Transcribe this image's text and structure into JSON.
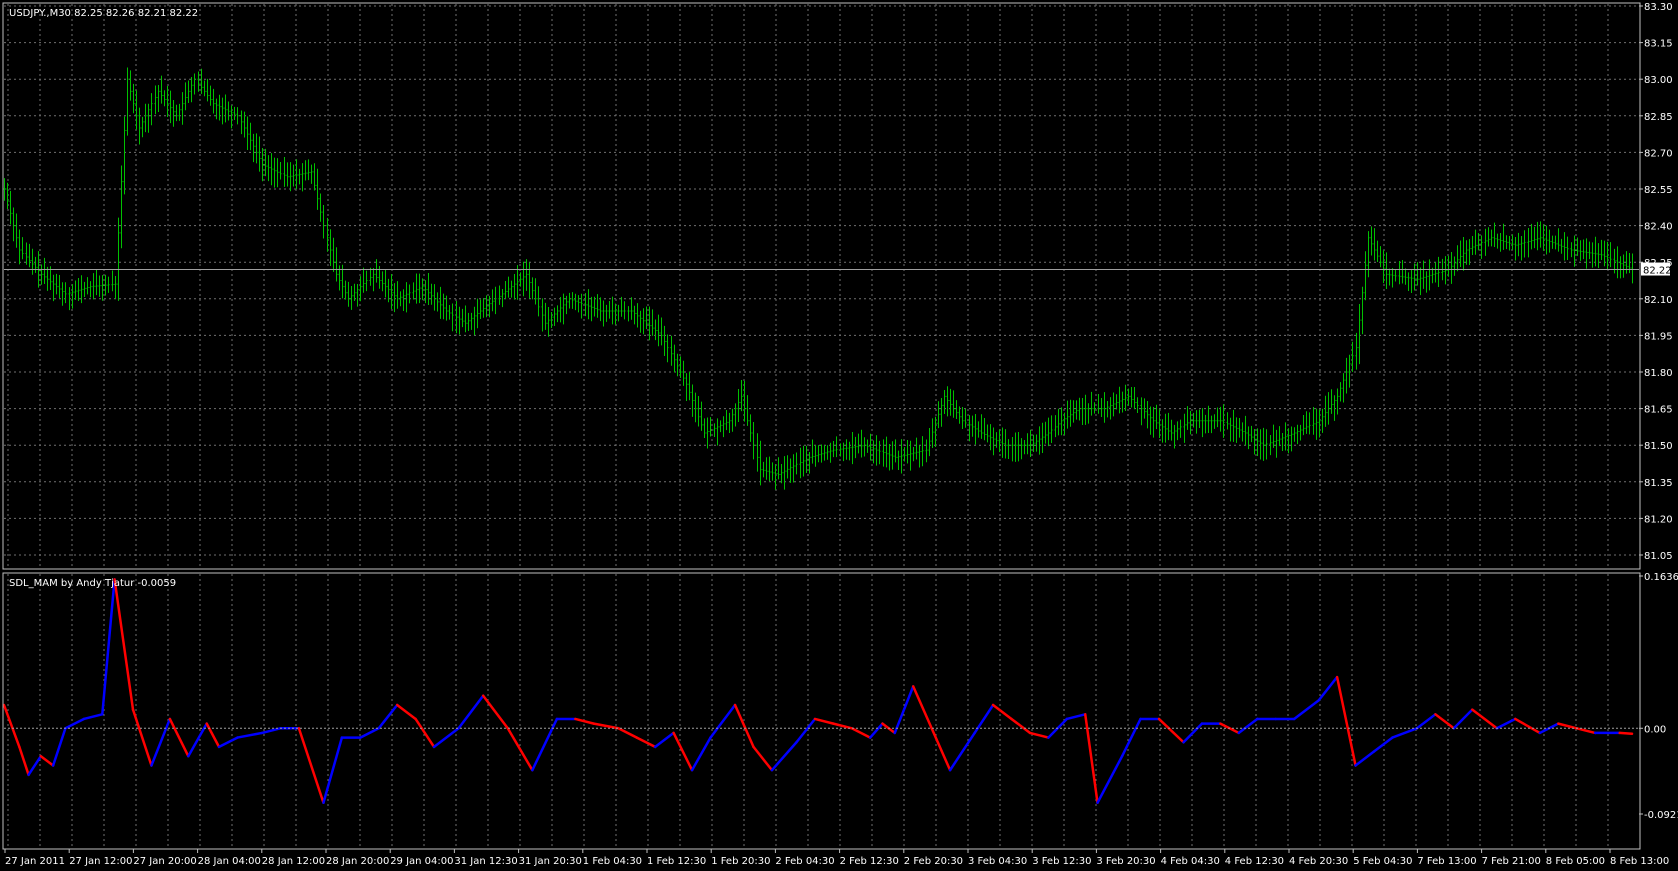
{
  "main": {
    "legend": "USDJPY.,M30  82.25 82.26 82.21 82.22",
    "price_label": "82.22",
    "y_ticks": [
      "83.30",
      "83.15",
      "83.00",
      "82.85",
      "82.70",
      "82.55",
      "82.40",
      "82.25",
      "82.10",
      "81.95",
      "81.80",
      "81.65",
      "81.50",
      "81.35",
      "81.20",
      "81.05"
    ]
  },
  "indicator": {
    "legend": "SDL_MAM by Andy Tjatur -0.0059",
    "y_ticks": [
      "0.1636",
      "0.00",
      "-0.0921"
    ]
  },
  "x_ticks": [
    "27 Jan 2011",
    "27 Jan 12:00",
    "27 Jan 20:00",
    "28 Jan 04:00",
    "28 Jan 12:00",
    "28 Jan 20:00",
    "29 Jan 04:00",
    "31 Jan 12:30",
    "31 Jan 20:30",
    "1 Feb 04:30",
    "1 Feb 12:30",
    "1 Feb 20:30",
    "2 Feb 04:30",
    "2 Feb 12:30",
    "2 Feb 20:30",
    "3 Feb 04:30",
    "3 Feb 12:30",
    "3 Feb 20:30",
    "4 Feb 04:30",
    "4 Feb 12:30",
    "4 Feb 20:30",
    "5 Feb 04:30",
    "7 Feb 13:00",
    "7 Feb 21:00",
    "8 Feb 05:00",
    "8 Feb 13:00"
  ],
  "colors": {
    "background": "#000000",
    "grid": "#707070",
    "bars": "#00c000",
    "osc_up": "#0000ff",
    "osc_down": "#ff0000",
    "text": "#ffffff"
  },
  "chart_data": [
    {
      "type": "line",
      "title": "USDJPY.,M30",
      "ylim": [
        81.05,
        83.3
      ],
      "close_path": [
        [
          0,
          82.55
        ],
        [
          5,
          82.3
        ],
        [
          12,
          82.2
        ],
        [
          20,
          82.12
        ],
        [
          28,
          82.15
        ],
        [
          36,
          82.16
        ],
        [
          40,
          83.0
        ],
        [
          44,
          82.8
        ],
        [
          50,
          82.95
        ],
        [
          56,
          82.85
        ],
        [
          62,
          83.0
        ],
        [
          68,
          82.9
        ],
        [
          76,
          82.85
        ],
        [
          84,
          82.65
        ],
        [
          92,
          82.6
        ],
        [
          100,
          82.62
        ],
        [
          104,
          82.4
        ],
        [
          108,
          82.2
        ],
        [
          112,
          82.1
        ],
        [
          120,
          82.2
        ],
        [
          128,
          82.1
        ],
        [
          136,
          82.15
        ],
        [
          144,
          82.05
        ],
        [
          150,
          82.0
        ],
        [
          160,
          82.1
        ],
        [
          170,
          82.2
        ],
        [
          176,
          82.0
        ],
        [
          184,
          82.1
        ],
        [
          194,
          82.05
        ],
        [
          204,
          82.05
        ],
        [
          214,
          81.95
        ],
        [
          222,
          81.75
        ],
        [
          228,
          81.55
        ],
        [
          236,
          81.6
        ],
        [
          240,
          81.7
        ],
        [
          246,
          81.4
        ],
        [
          252,
          81.38
        ],
        [
          262,
          81.45
        ],
        [
          270,
          81.48
        ],
        [
          280,
          81.5
        ],
        [
          290,
          81.45
        ],
        [
          300,
          81.48
        ],
        [
          306,
          81.7
        ],
        [
          312,
          81.6
        ],
        [
          318,
          81.55
        ],
        [
          326,
          81.5
        ],
        [
          334,
          81.5
        ],
        [
          340,
          81.55
        ],
        [
          344,
          81.6
        ],
        [
          350,
          81.65
        ],
        [
          358,
          81.65
        ],
        [
          366,
          81.7
        ],
        [
          374,
          81.6
        ],
        [
          380,
          81.55
        ],
        [
          386,
          81.6
        ],
        [
          396,
          81.6
        ],
        [
          404,
          81.55
        ],
        [
          410,
          81.5
        ],
        [
          420,
          81.55
        ],
        [
          428,
          81.6
        ],
        [
          434,
          81.7
        ],
        [
          440,
          81.9
        ],
        [
          444,
          82.35
        ],
        [
          450,
          82.2
        ],
        [
          460,
          82.18
        ],
        [
          470,
          82.22
        ],
        [
          476,
          82.3
        ],
        [
          484,
          82.35
        ],
        [
          492,
          82.32
        ],
        [
          500,
          82.35
        ],
        [
          510,
          82.3
        ],
        [
          520,
          82.28
        ],
        [
          530,
          82.22
        ]
      ],
      "x": [
        "27 Jan 2011",
        "27 Jan 12:00",
        "27 Jan 20:00",
        "28 Jan 04:00",
        "28 Jan 12:00",
        "28 Jan 20:00",
        "29 Jan 04:00",
        "31 Jan 12:30",
        "31 Jan 20:30",
        "1 Feb 04:30",
        "1 Feb 12:30",
        "1 Feb 20:30",
        "2 Feb 04:30",
        "2 Feb 12:30",
        "2 Feb 20:30",
        "3 Feb 04:30",
        "3 Feb 12:30",
        "3 Feb 20:30",
        "4 Feb 04:30",
        "4 Feb 12:30",
        "4 Feb 20:30",
        "5 Feb 04:30",
        "7 Feb 13:00",
        "7 Feb 21:00",
        "8 Feb 05:00",
        "8 Feb 13:00"
      ]
    },
    {
      "type": "line",
      "title": "SDL_MAM by Andy Tjatur",
      "ylim": [
        -0.0921,
        0.1636
      ],
      "last_value": -0.0059,
      "path": [
        [
          0,
          0.025
        ],
        [
          5,
          -0.02
        ],
        [
          8,
          -0.05
        ],
        [
          12,
          -0.03
        ],
        [
          16,
          -0.04
        ],
        [
          20,
          0.0
        ],
        [
          26,
          0.01
        ],
        [
          32,
          0.015
        ],
        [
          36,
          0.16
        ],
        [
          42,
          0.02
        ],
        [
          48,
          -0.04
        ],
        [
          54,
          0.01
        ],
        [
          60,
          -0.03
        ],
        [
          66,
          0.005
        ],
        [
          70,
          -0.02
        ],
        [
          76,
          -0.01
        ],
        [
          84,
          -0.005
        ],
        [
          90,
          0.0
        ],
        [
          96,
          0.0
        ],
        [
          104,
          -0.08
        ],
        [
          110,
          -0.01
        ],
        [
          116,
          -0.01
        ],
        [
          122,
          0.0
        ],
        [
          128,
          0.025
        ],
        [
          134,
          0.01
        ],
        [
          140,
          -0.02
        ],
        [
          148,
          0.0
        ],
        [
          156,
          0.035
        ],
        [
          164,
          0.0
        ],
        [
          172,
          -0.045
        ],
        [
          180,
          0.01
        ],
        [
          186,
          0.01
        ],
        [
          192,
          0.005
        ],
        [
          200,
          0.0
        ],
        [
          206,
          -0.01
        ],
        [
          212,
          -0.02
        ],
        [
          218,
          -0.005
        ],
        [
          224,
          -0.045
        ],
        [
          230,
          -0.01
        ],
        [
          238,
          0.025
        ],
        [
          244,
          -0.02
        ],
        [
          250,
          -0.045
        ],
        [
          258,
          -0.015
        ],
        [
          264,
          0.01
        ],
        [
          270,
          0.005
        ],
        [
          276,
          0.0
        ],
        [
          282,
          -0.01
        ],
        [
          286,
          0.005
        ],
        [
          290,
          -0.005
        ],
        [
          296,
          0.045
        ],
        [
          302,
          0.0
        ],
        [
          308,
          -0.045
        ],
        [
          316,
          -0.005
        ],
        [
          322,
          0.025
        ],
        [
          328,
          0.01
        ],
        [
          334,
          -0.005
        ],
        [
          340,
          -0.01
        ],
        [
          346,
          0.01
        ],
        [
          352,
          0.015
        ],
        [
          356,
          -0.08
        ],
        [
          364,
          -0.03
        ],
        [
          370,
          0.01
        ],
        [
          376,
          0.01
        ],
        [
          384,
          -0.015
        ],
        [
          390,
          0.005
        ],
        [
          396,
          0.005
        ],
        [
          402,
          -0.005
        ],
        [
          408,
          0.01
        ],
        [
          414,
          0.01
        ],
        [
          420,
          0.01
        ],
        [
          428,
          0.03
        ],
        [
          434,
          0.055
        ],
        [
          440,
          -0.04
        ],
        [
          446,
          -0.025
        ],
        [
          452,
          -0.01
        ],
        [
          460,
          0.0
        ],
        [
          466,
          0.015
        ],
        [
          472,
          0.0
        ],
        [
          478,
          0.02
        ],
        [
          486,
          0.0
        ],
        [
          492,
          0.01
        ],
        [
          500,
          -0.005
        ],
        [
          506,
          0.005
        ],
        [
          512,
          0.0
        ],
        [
          518,
          -0.005
        ],
        [
          526,
          -0.005
        ],
        [
          530,
          -0.0059
        ]
      ]
    }
  ]
}
